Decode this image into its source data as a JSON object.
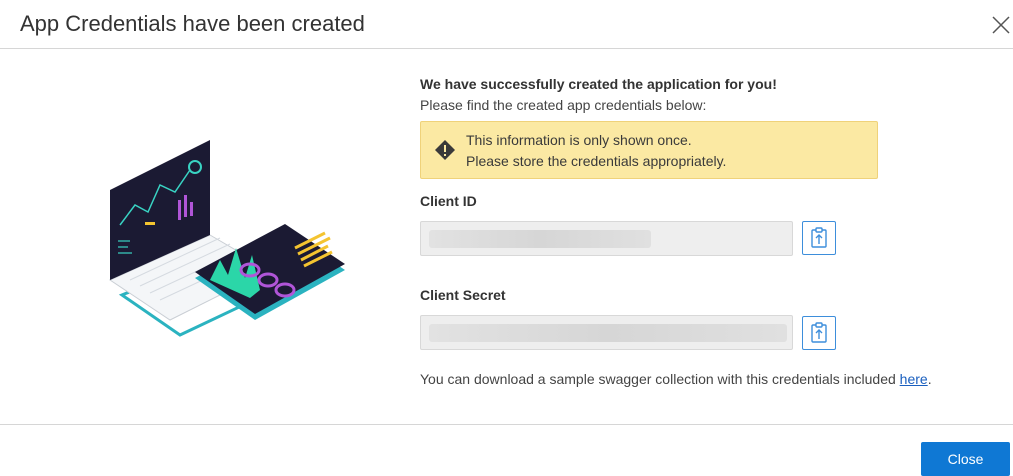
{
  "dialog": {
    "title": "App Credentials have been created",
    "close_icon": "close-icon"
  },
  "content": {
    "heading": "We have successfully created the application for you!",
    "subheading": "Please find the created app credentials below:",
    "warning": {
      "icon": "warning-diamond-icon",
      "line1": "This information is only shown once.",
      "line2": "Please store the credentials appropriately."
    },
    "client_id": {
      "label": "Client ID",
      "value": ""
    },
    "client_secret": {
      "label": "Client Secret",
      "value": ""
    },
    "copy_icon": "clipboard-copy-icon",
    "footnote": {
      "text": "You can download a sample swagger collection with this credentials included ",
      "link": "here",
      "suffix": "."
    }
  },
  "footer": {
    "close_label": "Close"
  },
  "colors": {
    "primary": "#0f78d4",
    "warning_bg": "#fbe9a3",
    "accent_teal": "#2bb3c0"
  }
}
